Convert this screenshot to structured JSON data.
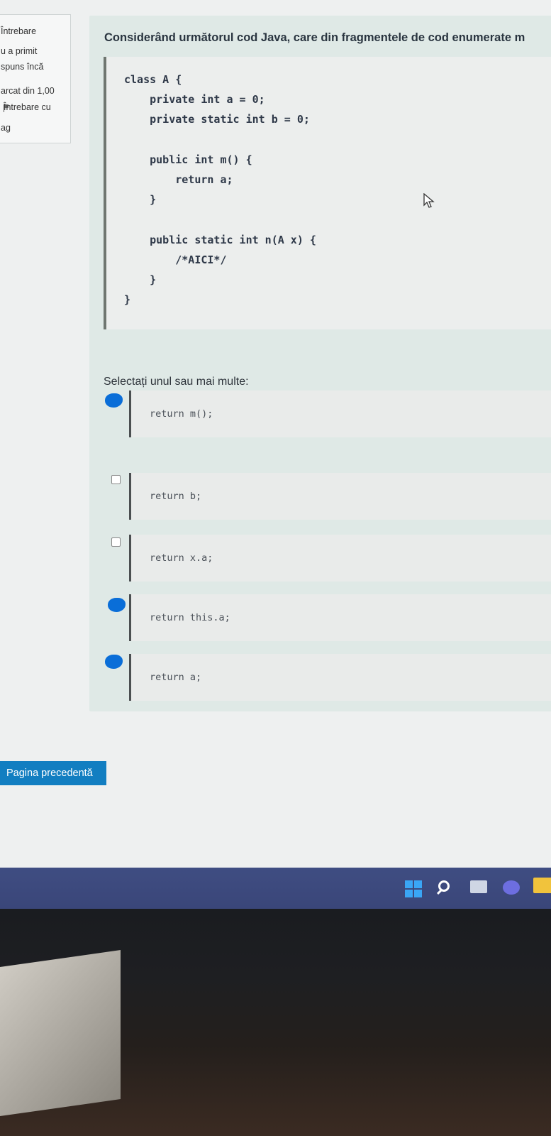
{
  "sidebar": {
    "lines": [
      "Întrebare",
      "u a primit",
      "spuns încă",
      "arcat din 1,00",
      "Întrebare cu",
      "ag"
    ]
  },
  "question": {
    "title": "Considerând următorul cod Java, care din fragmentele de cod enumerate m",
    "code": "class A {\n    private int a = 0;\n    private static int b = 0;\n\n    public int m() {\n        return a;\n    }\n\n    public static int n(A x) {\n        /*AICI*/\n    }\n}",
    "prompt": "Selectați unul sau mai multe:",
    "options": [
      {
        "code": "return m();",
        "checked": true
      },
      {
        "code": "return b;",
        "checked": false
      },
      {
        "code": "return x.a;",
        "checked": false
      },
      {
        "code": "return this.a;",
        "checked": true
      },
      {
        "code": "return a;",
        "checked": true
      }
    ]
  },
  "navigation": {
    "prev_label": "Pagina precedentă"
  },
  "colors": {
    "accent": "#127ec1",
    "mark": "#0a6ed8",
    "taskbar": "#3c4a7f"
  },
  "taskbar": {
    "icons": [
      "windows-start-icon",
      "search-icon",
      "task-view-icon",
      "chat-icon",
      "file-explorer-icon"
    ]
  }
}
